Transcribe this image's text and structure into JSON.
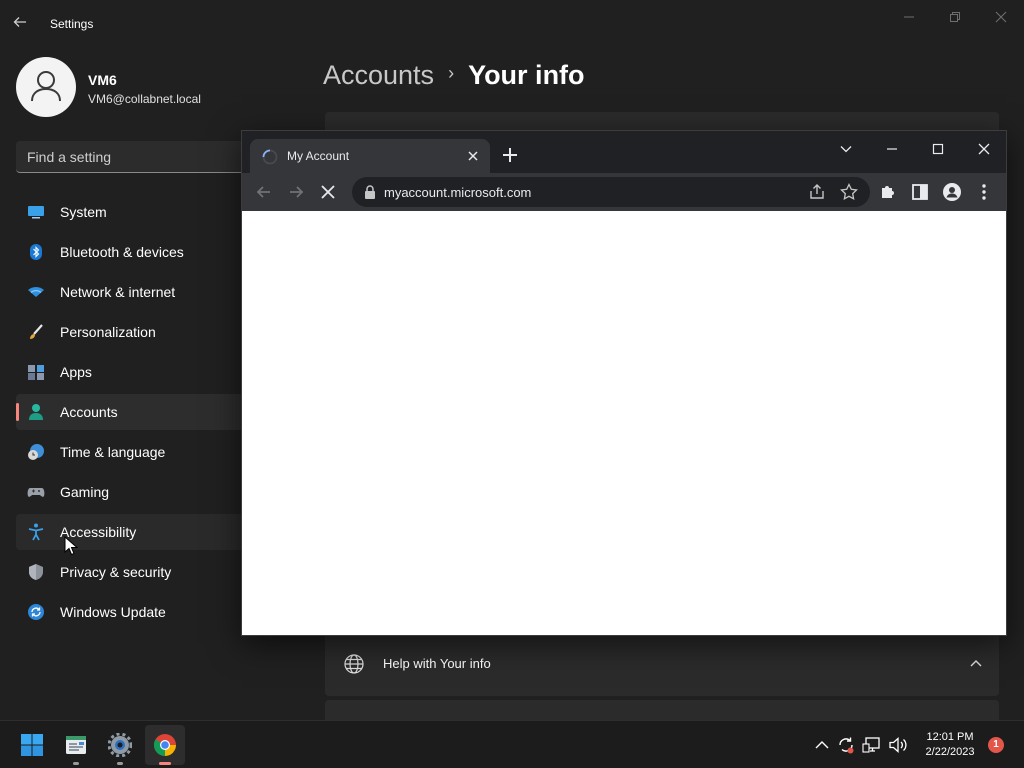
{
  "settings": {
    "title": "Settings",
    "user": {
      "name": "VM6",
      "email": "VM6@collabnet.local"
    },
    "search_placeholder": "Find a setting",
    "nav": [
      {
        "label": "System",
        "icon": "monitor-icon"
      },
      {
        "label": "Bluetooth & devices",
        "icon": "bluetooth-icon"
      },
      {
        "label": "Network & internet",
        "icon": "wifi-icon"
      },
      {
        "label": "Personalization",
        "icon": "brush-icon"
      },
      {
        "label": "Apps",
        "icon": "apps-icon"
      },
      {
        "label": "Accounts",
        "icon": "person-icon",
        "active": true
      },
      {
        "label": "Time & language",
        "icon": "clock-globe-icon"
      },
      {
        "label": "Gaming",
        "icon": "gamepad-icon"
      },
      {
        "label": "Accessibility",
        "icon": "accessibility-icon"
      },
      {
        "label": "Privacy & security",
        "icon": "shield-icon"
      },
      {
        "label": "Windows Update",
        "icon": "update-icon"
      }
    ],
    "breadcrumb": {
      "parent": "Accounts",
      "separator": "›",
      "current": "Your info"
    },
    "help_section": {
      "label": "Help with Your info"
    }
  },
  "browser": {
    "tab_title": "My Account",
    "url": "myaccount.microsoft.com",
    "loading": true
  },
  "taskbar": {
    "apps": [
      {
        "name": "start-button",
        "icon": "windows-logo-icon"
      },
      {
        "name": "taskbar-app-notepad",
        "icon": "notepad-icon"
      },
      {
        "name": "taskbar-app-settings",
        "icon": "gear-icon"
      },
      {
        "name": "taskbar-app-chrome",
        "icon": "chrome-icon",
        "active": true
      }
    ],
    "time": "12:01 PM",
    "date": "2/22/2023",
    "notification_count": "1"
  },
  "colors": {
    "background": "#202020",
    "accent": "#f7867e",
    "browser_chrome": "#35363a",
    "notification_badge": "#e3574b"
  }
}
